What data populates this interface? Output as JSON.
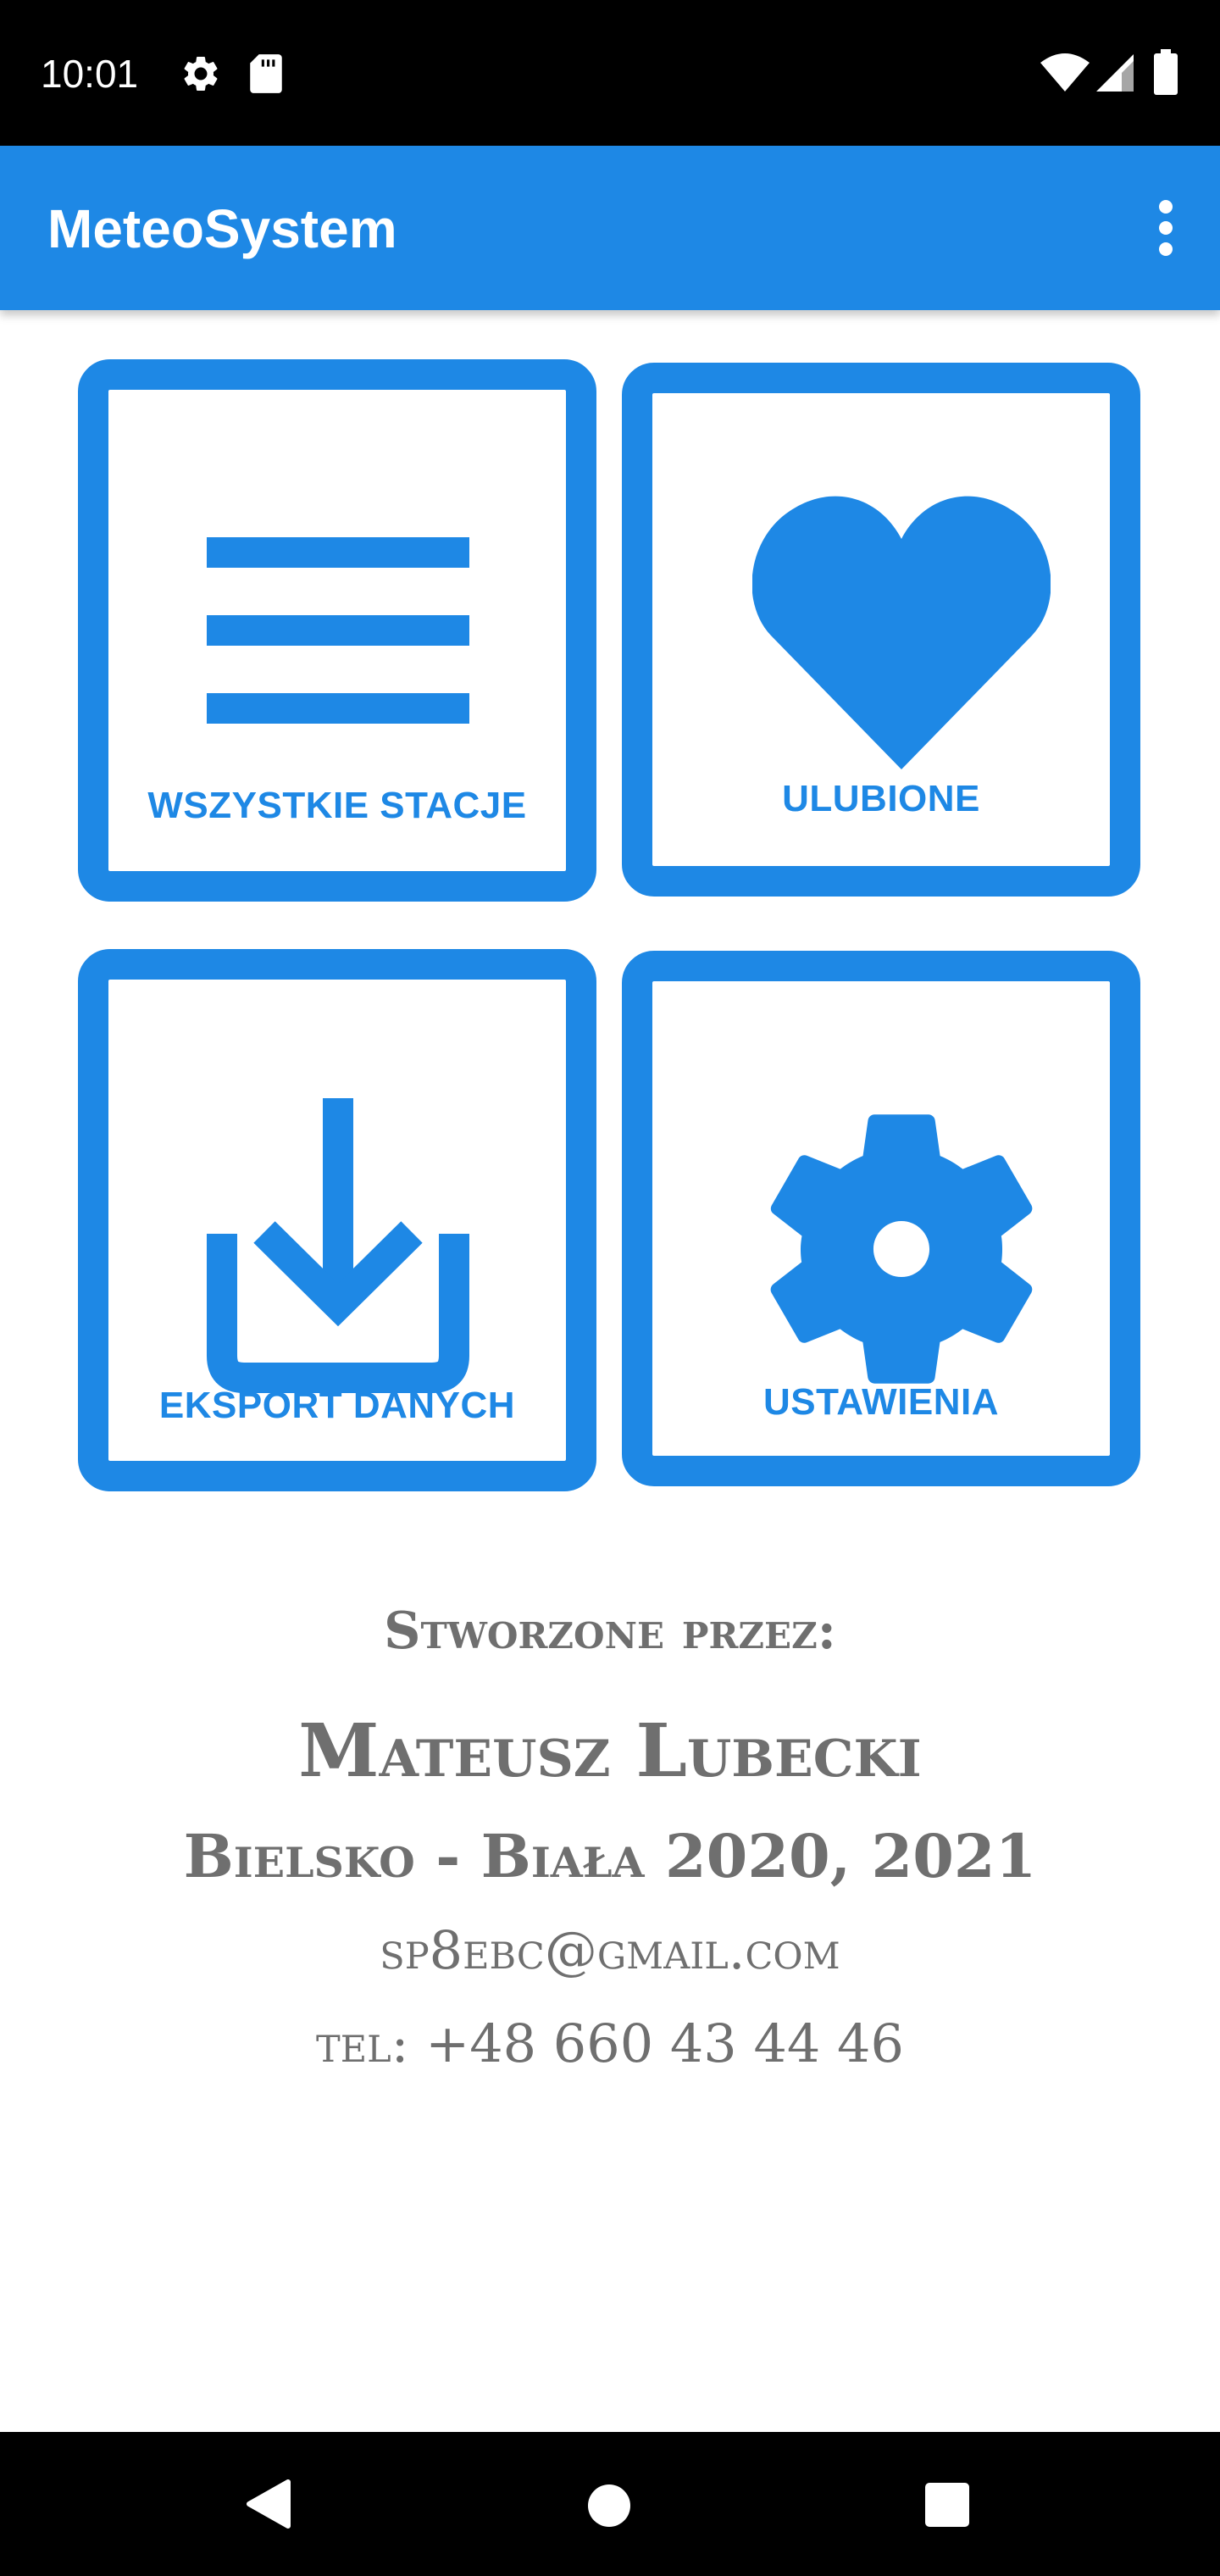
{
  "status_bar": {
    "time": "10:01",
    "icons": [
      "settings-gear-icon",
      "sd-card-icon",
      "wifi-icon",
      "cellular-signal-icon",
      "battery-icon"
    ]
  },
  "app_bar": {
    "title": "MeteoSystem",
    "overflow_icon": "more-vertical-icon"
  },
  "tiles": [
    {
      "label": "WSZYSTKIE STACJE",
      "icon": "list-icon"
    },
    {
      "label": "ULUBIONE",
      "icon": "heart-icon"
    },
    {
      "label": "EKSPORT DANYCH",
      "icon": "download-icon"
    },
    {
      "label": "USTAWIENIA",
      "icon": "gear-icon"
    }
  ],
  "credits": {
    "heading": "Stworzone przez:",
    "author": "Mateusz Lubecki",
    "place": "Bielsko - Biała 2020, 2021",
    "email": "sp8ebc@gmail.com",
    "phone": "tel: +48 660 43 44 46"
  },
  "nav_bar": {
    "buttons": [
      "back-icon",
      "home-icon",
      "recents-icon"
    ]
  },
  "colors": {
    "accent": "#1E88E5",
    "text_muted": "#6F6F6F",
    "system_bar": "#000000"
  }
}
